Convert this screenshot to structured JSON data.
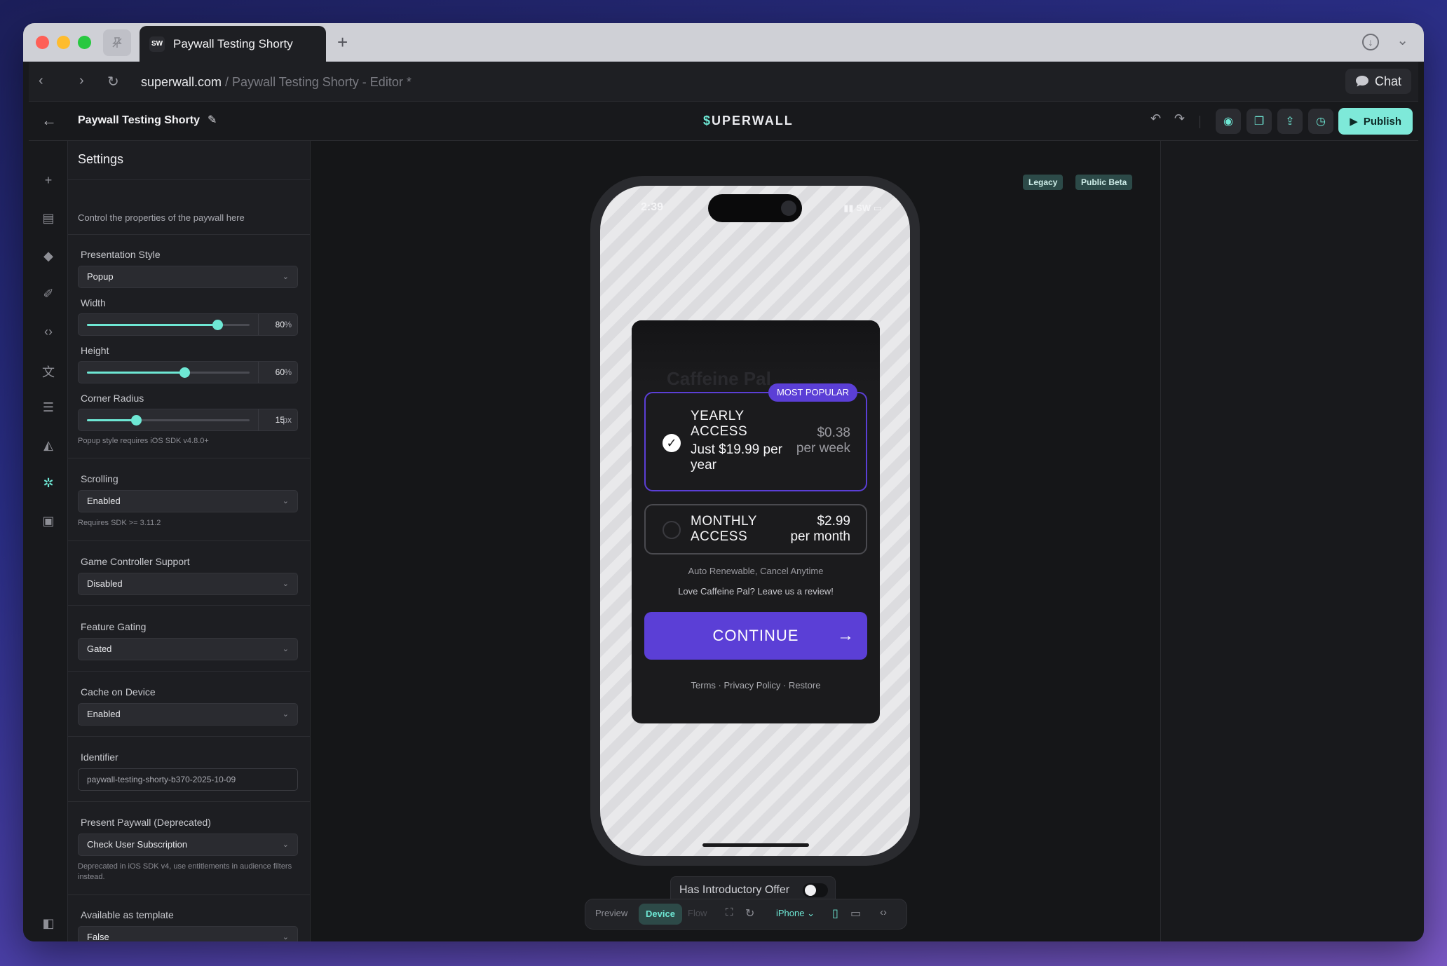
{
  "browser": {
    "tab_title": "Paywall Testing Shorty",
    "tab_favicon": "SW",
    "url_host": "superwall.com",
    "url_path": " / Paywall Testing Shorty - Editor *",
    "chat_label": "Chat"
  },
  "editor": {
    "paywall_name": "Paywall Testing Shorty",
    "logo_prefix": "$",
    "logo_text": "UPERWALL",
    "publish_label": "Publish",
    "badges": [
      "Legacy",
      "Public Beta"
    ]
  },
  "settings": {
    "title": "Settings",
    "subtitle": "Control the properties of the paywall here",
    "presentation_style": {
      "label": "Presentation Style",
      "value": "Popup"
    },
    "width": {
      "label": "Width",
      "value": "80",
      "unit": "%",
      "fraction": 0.8
    },
    "height": {
      "label": "Height",
      "value": "60",
      "unit": "%",
      "fraction": 0.6
    },
    "corner_radius": {
      "label": "Corner Radius",
      "value": "15",
      "unit": "px",
      "fraction": 0.3
    },
    "popup_note": "Popup style requires iOS SDK v4.8.0+",
    "scrolling": {
      "label": "Scrolling",
      "value": "Enabled",
      "note": "Requires SDK >= 3.11.2"
    },
    "game_controller": {
      "label": "Game Controller Support",
      "value": "Disabled"
    },
    "feature_gating": {
      "label": "Feature Gating",
      "value": "Gated"
    },
    "cache_on_device": {
      "label": "Cache on Device",
      "value": "Enabled"
    },
    "identifier": {
      "label": "Identifier",
      "value": "paywall-testing-shorty-b370-2025-10-09"
    },
    "present_paywall": {
      "label": "Present Paywall (Deprecated)",
      "value": "Check User Subscription",
      "note": "Deprecated in iOS SDK v4, use entitlements in audience filters instead."
    },
    "available_template": {
      "label": "Available as template",
      "value": "False"
    }
  },
  "device": {
    "time": "2:39",
    "carrier": "SW",
    "header_text": "Caffeine Pal"
  },
  "paywall": {
    "most_popular": "MOST POPULAR",
    "yearly": {
      "name_line1": "YEARLY",
      "name_line2": "ACCESS",
      "desc": "Just $19.99 per year",
      "price": "$0.38",
      "per": "per week"
    },
    "monthly": {
      "name_line1": "MONTHLY",
      "name_line2": "ACCESS",
      "price": "$2.99",
      "per": "per month"
    },
    "auto_renew": "Auto Renewable, Cancel Anytime",
    "review": "Love Caffeine Pal? Leave us a review!",
    "continue": "CONTINUE",
    "links": "Terms  ·  Privacy Policy  ·  Restore"
  },
  "controls": {
    "intro_offer": "Has Introductory Offer",
    "preview": "Preview",
    "device": "Device",
    "flow": "Flow",
    "device_type": "iPhone"
  },
  "colors": {
    "accent": "#6ee7d4",
    "paywall_purple": "#5b3fd6"
  }
}
